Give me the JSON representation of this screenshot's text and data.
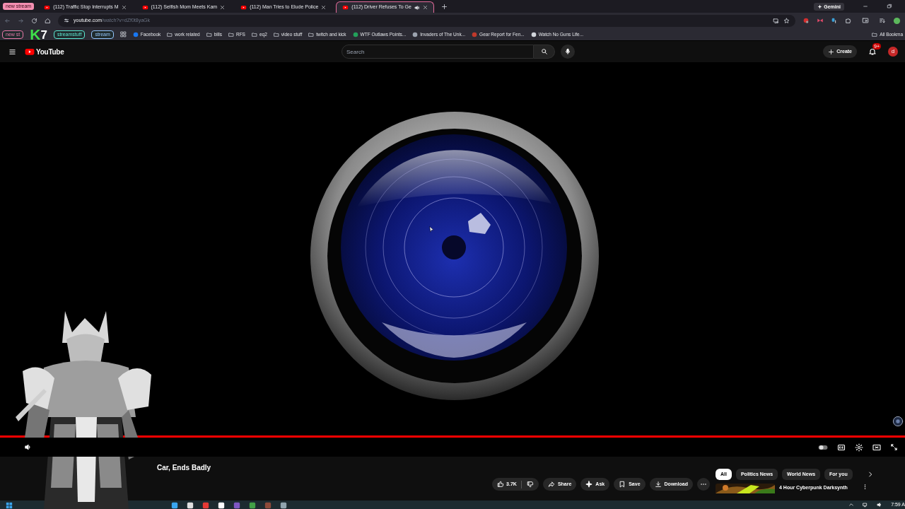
{
  "browser": {
    "tab_group": {
      "label": "new stream"
    },
    "tabs": [
      {
        "label": "(112) Traffic Stop Interrupts M",
        "selected": false,
        "playing_audio": false
      },
      {
        "label": "(112) Selfish Mom Meets Kam",
        "selected": false,
        "playing_audio": false
      },
      {
        "label": "(112) Man Tries to Elude Police",
        "selected": false,
        "playing_audio": false
      },
      {
        "label": "(112) Driver Refuses To Ge",
        "selected": true,
        "playing_audio": true
      }
    ],
    "gemini_button": "Gemini",
    "address_bar": {
      "host": "youtube.com",
      "path": "/watch?v=dZf0t8yaGk"
    },
    "bookmarks": [
      {
        "kind": "pill",
        "label": "new st",
        "color": "#e879a8"
      },
      {
        "kind": "pill",
        "label": "streamstuff",
        "color": "#5eead4"
      },
      {
        "kind": "pill",
        "label": "stream",
        "color": "#93c5fd"
      },
      {
        "kind": "apps"
      },
      {
        "kind": "link",
        "label": "Facebook",
        "color": "#1877f2"
      },
      {
        "kind": "folder",
        "label": "work related"
      },
      {
        "kind": "folder",
        "label": "bills"
      },
      {
        "kind": "folder",
        "label": "RFS"
      },
      {
        "kind": "folder",
        "label": "eq2"
      },
      {
        "kind": "folder",
        "label": "video stuff"
      },
      {
        "kind": "folder",
        "label": "twitch and kick"
      },
      {
        "kind": "link",
        "label": "WTF Outlaws Points...",
        "color": "#22a05a"
      },
      {
        "kind": "link",
        "label": "Invaders of The Unk...",
        "color": "#9ca3af"
      },
      {
        "kind": "link",
        "label": "Gear Report for Fen...",
        "color": "#c0392b"
      },
      {
        "kind": "link",
        "label": "Watch No Guns Life...",
        "color": "#d1d5db"
      }
    ],
    "all_bookmarks": "All Bookma"
  },
  "overlay_logo": {
    "letter": "K",
    "digit": "7"
  },
  "youtube": {
    "logo": "YouTube",
    "search": {
      "placeholder": "Search"
    },
    "create_button": "Create",
    "notification_badge": "9+",
    "avatar": "d",
    "progress": {
      "level": 1
    },
    "title": "Car, Ends Badly",
    "like_count": "3.7K",
    "actions": [
      {
        "kind": "share",
        "label": "Share"
      },
      {
        "kind": "ask",
        "label": "Ask"
      },
      {
        "kind": "save",
        "label": "Save"
      },
      {
        "kind": "download",
        "label": "Download"
      }
    ],
    "chips": [
      {
        "label": "All",
        "selected": true
      },
      {
        "label": "Politics News",
        "selected": false
      },
      {
        "label": "World News",
        "selected": false
      },
      {
        "label": "For you",
        "selected": false
      }
    ],
    "recommendation": {
      "title": "4 Hour Cyberpunk Darksynth"
    }
  },
  "taskbar": {
    "clock": "7:59 A"
  }
}
